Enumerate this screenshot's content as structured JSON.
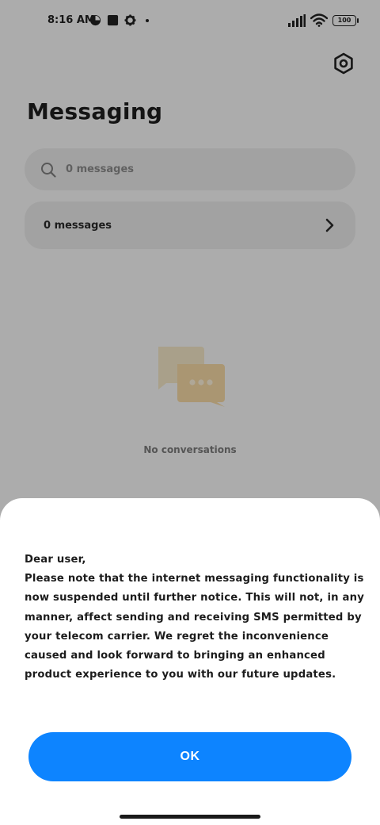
{
  "status_bar": {
    "time": "8:16 AM",
    "battery": "100",
    "icons": [
      "app-notification-icon",
      "square-app-icon",
      "gear-notification-icon",
      "dot-icon",
      "signal-icon",
      "wifi-icon",
      "battery-icon"
    ]
  },
  "header": {
    "title": "Messaging",
    "settings_icon": "settings-hexagon-icon"
  },
  "search": {
    "placeholder": "0 messages"
  },
  "messages_card": {
    "label": "0 messages"
  },
  "empty_state": {
    "text": "No conversations",
    "icon": "chat-bubbles-icon"
  },
  "dialog": {
    "greeting": "Dear user,",
    "body": "Please note that the internet messaging functionality is now suspended until further notice. This will not,  in any manner,  affect sending and receiving SMS permitted by your telecom carrier. We regret the inconvenience caused and look forward to bringing an enhanced product experience to you with our future updates.",
    "ok_label": "OK"
  },
  "colors": {
    "accent": "#0d84ff",
    "sheet_bg": "#ffffff",
    "dim_overlay": "rgba(0,0,0,0.30)"
  }
}
